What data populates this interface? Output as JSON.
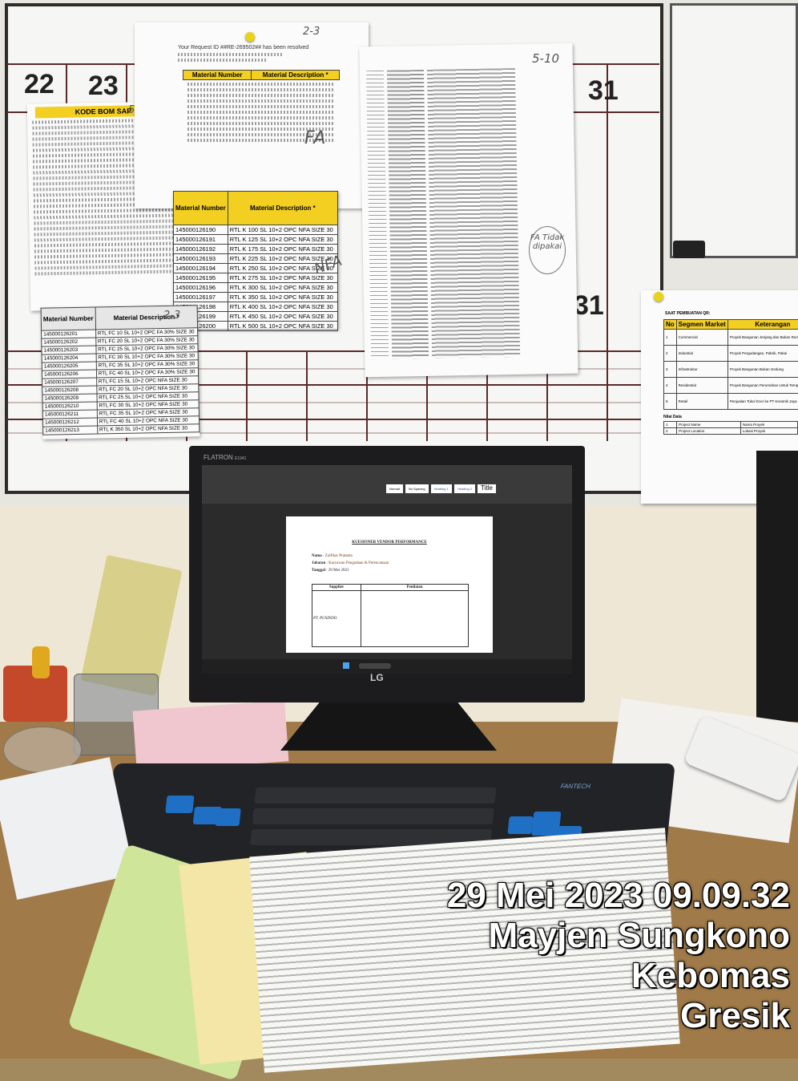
{
  "board_numbers": [
    "22",
    "23",
    "31",
    "31"
  ],
  "notes": {
    "left_handwriting": "5-10",
    "top_handwriting": "2-3",
    "right_handwriting": "5-10",
    "bottom_handwriting": "2-3",
    "fa": "FA",
    "nfa": "NFA",
    "fa_tidak": "FA Tidak dipakai"
  },
  "request_sheet": {
    "title": "Your Request ID ##RE-269502## has been resolved",
    "col_material": "Material Number",
    "col_desc": "Material Description *"
  },
  "kode_bom": {
    "header": "KODE BOM SAP"
  },
  "rtl_table": {
    "col_material": "Material Number",
    "col_desc": "Material Description *",
    "rows": [
      [
        "145000126190",
        "RTL K 100 SL 10+2 OPC NFA SIZE 30"
      ],
      [
        "145000126191",
        "RTL K 125 SL 10+2 OPC NFA SIZE 30"
      ],
      [
        "145000126192",
        "RTL K 175 SL 10+2 OPC NFA SIZE 30"
      ],
      [
        "145000126193",
        "RTL K 225 SL 10+2 OPC NFA SIZE 30"
      ],
      [
        "145000126194",
        "RTL K 250 SL 10+2 OPC NFA SIZE 30"
      ],
      [
        "145000126195",
        "RTL K 275 SL 10+2 OPC NFA SIZE 30"
      ],
      [
        "145000126196",
        "RTL K 300 SL 10+2 OPC NFA SIZE 30"
      ],
      [
        "145000126197",
        "RTL K 350 SL 10+2 OPC NFA SIZE 30"
      ],
      [
        "145000126198",
        "RTL K 400 SL 10+2 OPC NFA SIZE 30"
      ],
      [
        "145000126199",
        "RTL K 450 SL 10+2 OPC NFA SIZE 30"
      ],
      [
        "145000126200",
        "RTL K 500 SL 10+2 OPC NFA SIZE 30"
      ]
    ]
  },
  "fc_table": {
    "col_material": "Material Number",
    "col_desc": "Material Description *",
    "rows": [
      [
        "145000126201",
        "RTL FC 10 SL 10+2 OPC FA 30% SIZE 30"
      ],
      [
        "145000126202",
        "RTL FC 20 SL 10+2 OPC FA 30% SIZE 30"
      ],
      [
        "145000126203",
        "RTL FC 25 SL 10+2 OPC FA 30% SIZE 30"
      ],
      [
        "145000126204",
        "RTL FC 30 SL 10+2 OPC FA 30% SIZE 30"
      ],
      [
        "145000126205",
        "RTL FC 35 SL 10+2 OPC FA 30% SIZE 30"
      ],
      [
        "145000126206",
        "RTL FC 40 SL 10+2 OPC FA 30% SIZE 30"
      ],
      [
        "145000126207",
        "RTL FC 15 SL 10+2 OPC NFA SIZE 30"
      ],
      [
        "145000126208",
        "RTL FC 20 SL 10+2 OPC NFA SIZE 30"
      ],
      [
        "145000126209",
        "RTL FC 25 SL 10+2 OPC NFA SIZE 30"
      ],
      [
        "145000126210",
        "RTL FC 30 SL 10+2 OPC NFA SIZE 30"
      ],
      [
        "145000126211",
        "RTL FC 35 SL 10+2 OPC NFA SIZE 30"
      ],
      [
        "145000126212",
        "RTL FC 40 SL 10+2 OPC NFA SIZE 30"
      ],
      [
        "145000126213",
        "RTL K 350 SL 10+2 OPC NFA SIZE 30"
      ]
    ]
  },
  "segment_sheet": {
    "title": "SAAT PEMBUATAN QR:",
    "col_no": "No",
    "col_segment": "Segmen Market",
    "col_ket": "Keterangan",
    "rows": [
      [
        "1",
        "Commercial",
        "Proyek Bangunan Jenjang dan Bukan Rumah Tinggal"
      ],
      [
        "2",
        "Industrial",
        "Proyek Pergudangan, Pabrik, Pakai"
      ],
      [
        "3",
        "Infrastruktur",
        "Proyek Bangunan Bukan Gedung"
      ],
      [
        "4",
        "Residential",
        "Proyek Bangunan Perumahan Untuk Tempat Tinggal"
      ],
      [
        "5",
        "Retail",
        "Penjualan Toko/ Ecer ke PT Keramik Jaya Rauh"
      ]
    ],
    "sub_title": "Nilai Data",
    "sub_rows": [
      [
        "1",
        "Project Name",
        "Nama Proyek"
      ],
      [
        "2",
        "Project Location",
        "Lokasi Proyek"
      ]
    ]
  },
  "monitor": {
    "brand": "FLATRON",
    "model": "E1941",
    "logo": "LG",
    "doc_title": "KUESIONER VENDOR PERFORMANCE",
    "doc_nama_label": "Nama",
    "doc_nama": ": Zulfikar Pratama",
    "doc_jabatan_label": "Jabatan",
    "doc_jabatan": ": Karyawan Pengadaan & Perencanaan",
    "doc_tanggal_label": "Tanggal",
    "doc_tanggal": ": 29 Mei 2023",
    "col_supplier": "Supplier",
    "col_penilaian": "Penilaian",
    "supplier": "PT. PUSINDO",
    "styles": [
      "Normal",
      "No Spacing",
      "Heading 1",
      "Heading 2",
      "Title"
    ]
  },
  "keyboard_brand": "FANTECH",
  "stamp": {
    "datetime": "29 Mei 2023 09.09.32",
    "street": "Mayjen Sungkono",
    "district": "Kebomas",
    "city": "Gresik"
  }
}
